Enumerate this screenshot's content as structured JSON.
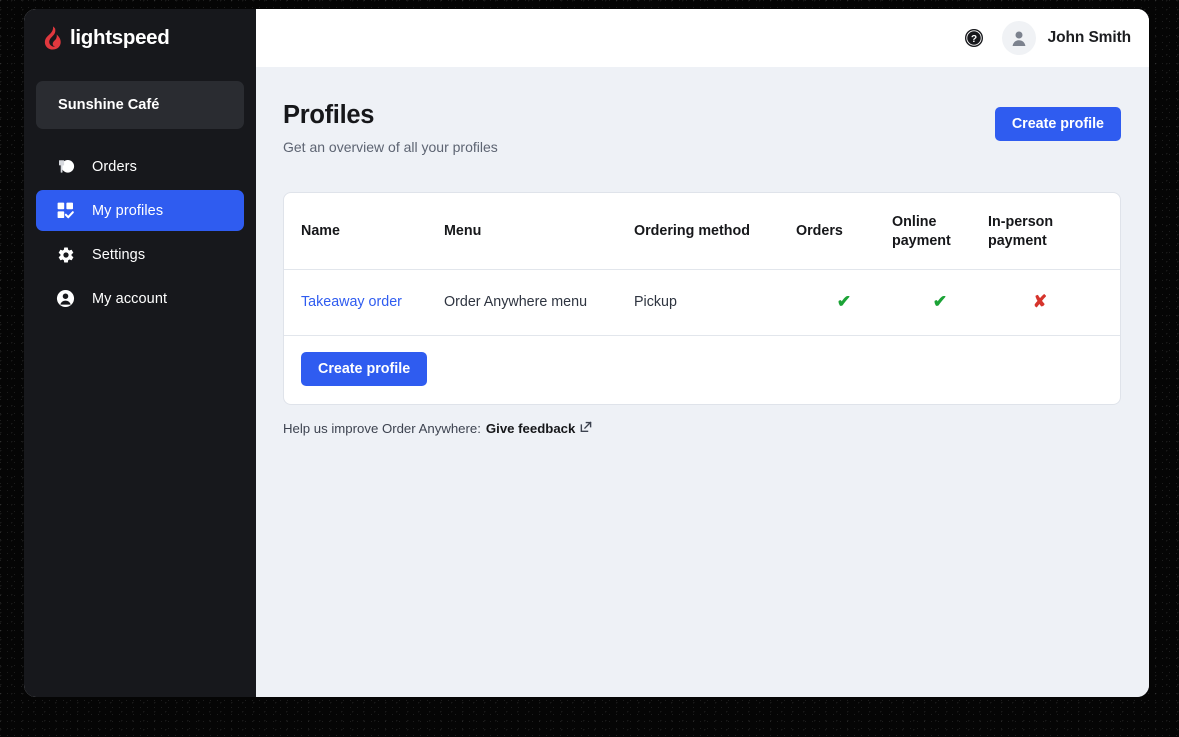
{
  "brand": {
    "logo_icon": "lightspeed-flame-icon",
    "logo_text": "lightspeed",
    "accent_color": "#2f5cf0",
    "flame_color": "#e0383e",
    "sidebar_color": "#17181c",
    "content_bg": "#eef1f6"
  },
  "sidebar": {
    "store_name": "Sunshine Café",
    "items": [
      {
        "label": "Orders",
        "icon": "plate-cutlery-icon",
        "active": false
      },
      {
        "label": "My profiles",
        "icon": "grid-check-icon",
        "active": true
      },
      {
        "label": "Settings",
        "icon": "gear-icon",
        "active": false
      },
      {
        "label": "My account",
        "icon": "user-circle-icon",
        "active": false
      }
    ]
  },
  "topbar": {
    "help_icon": "help-circle-icon",
    "avatar_icon": "user-avatar-icon",
    "user_name": "John Smith"
  },
  "page": {
    "title": "Profiles",
    "subtitle": "Get an overview of all your profiles",
    "create_button": "Create profile"
  },
  "table": {
    "headers": {
      "name": "Name",
      "menu": "Menu",
      "method": "Ordering method",
      "orders": "Orders",
      "online_payment": "Online payment",
      "inperson_payment": "In-person payment",
      "action": ""
    },
    "rows": [
      {
        "name": "Takeaway order",
        "menu": "Order Anywhere menu",
        "method": "Pickup",
        "orders": "✔",
        "online_payment": "✔",
        "inperson_payment": "✘",
        "action_icon": "external-link-icon"
      }
    ],
    "footer_button": "Create profile"
  },
  "feedback": {
    "text": "Help us improve Order Anywhere:",
    "link": "Give feedback",
    "icon": "external-link-icon"
  }
}
